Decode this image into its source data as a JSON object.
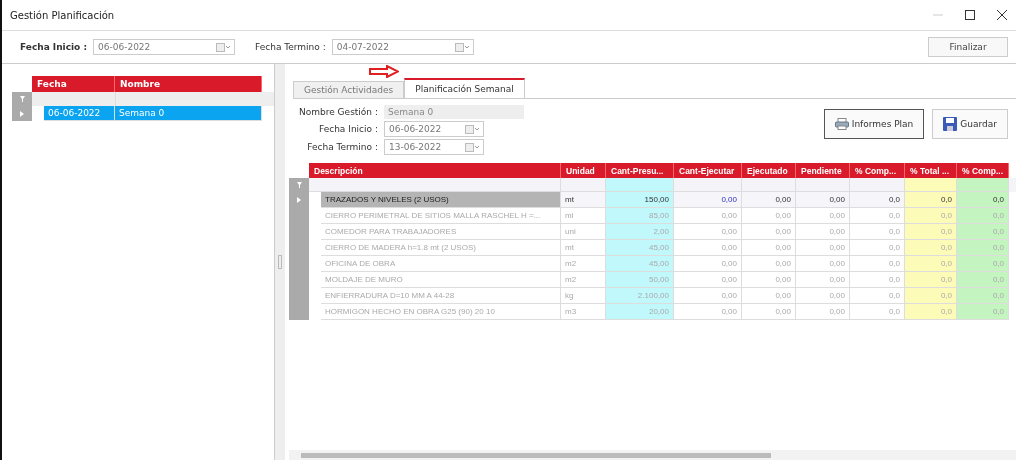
{
  "window": {
    "title": "Gestión Planificación"
  },
  "header": {
    "fecha_inicio": {
      "label": "Fecha Inicio :",
      "value": "06-06-2022"
    },
    "fecha_termino": {
      "label": "Fecha Termino :",
      "value": "04-07-2022"
    },
    "finalizar_button": "Finalizar"
  },
  "left_grid": {
    "columns": [
      "Fecha",
      "Nombre"
    ],
    "rows": [
      {
        "fecha": "06-06-2022",
        "nombre": "Semana 0",
        "selected": true
      }
    ]
  },
  "tabs": [
    {
      "label": "Gestión Actividades",
      "selected": false
    },
    {
      "label": "Planificación Semanal",
      "selected": true
    }
  ],
  "form": {
    "nombre_gestion": {
      "label": "Nombre Gestión :",
      "value": "Semana 0"
    },
    "fecha_inicio": {
      "label": "Fecha Inicio :",
      "value": "06-06-2022"
    },
    "fecha_termino": {
      "label": "Fecha Termino :",
      "value": "13-06-2022"
    }
  },
  "buttons": [
    "Informes Plan",
    "Guardar"
  ],
  "table": {
    "columns": [
      {
        "label": "Descripción"
      },
      {
        "label": "Unidad"
      },
      {
        "label": "Cant-Presu...",
        "color": "#c0f8fc"
      },
      {
        "label": "Cant-Ejecutar"
      },
      {
        "label": "Ejecutado"
      },
      {
        "label": "Pendiente"
      },
      {
        "label": "% Comp..."
      },
      {
        "label": "% Total ...",
        "color": "#fcfcb8"
      },
      {
        "label": "% Comp...",
        "color": "#c4f4c0"
      }
    ],
    "rows": [
      {
        "selected": true,
        "cells": [
          "TRAZADOS Y NIVELES (2 USOS)",
          "mt",
          "150,00",
          "0,00",
          "0,00",
          "0,00",
          "0,0",
          "0,0",
          "0,0"
        ]
      },
      {
        "selected": false,
        "cells": [
          "CIERRO PERIMETRAL DE SITIOS MALLA RASCHEL H =...",
          "ml",
          "85,00",
          "0,00",
          "0,00",
          "0,00",
          "0,0",
          "0,0",
          "0,0"
        ]
      },
      {
        "selected": false,
        "cells": [
          "COMEDOR PARA TRABAJADORES",
          "uni",
          "2,00",
          "0,00",
          "0,00",
          "0,00",
          "0,0",
          "0,0",
          "0,0"
        ]
      },
      {
        "selected": false,
        "cells": [
          "CIERRO DE MADERA h=1.8 mt  (2 USOS)",
          "mt",
          "45,00",
          "0,00",
          "0,00",
          "0,00",
          "0,0",
          "0,0",
          "0,0"
        ]
      },
      {
        "selected": false,
        "cells": [
          "OFICINA DE OBRA",
          "m2",
          "45,00",
          "0,00",
          "0,00",
          "0,00",
          "0,0",
          "0,0",
          "0,0"
        ]
      },
      {
        "selected": false,
        "cells": [
          "MOLDAJE DE MURO",
          "m2",
          "50,00",
          "0,00",
          "0,00",
          "0,00",
          "0,0",
          "0,0",
          "0,0"
        ]
      },
      {
        "selected": false,
        "cells": [
          "ENFIERRADURA D=10 MM A 44-28",
          "kg",
          "2.100,00",
          "0,00",
          "0,00",
          "0,00",
          "0,0",
          "0,0",
          "0,0"
        ]
      },
      {
        "selected": false,
        "cells": [
          "HORMIGON HECHO EN OBRA G25 (90) 20 10",
          "m3",
          "20,00",
          "0,00",
          "0,00",
          "0,00",
          "0,0",
          "0,0",
          "0,0"
        ]
      }
    ]
  }
}
